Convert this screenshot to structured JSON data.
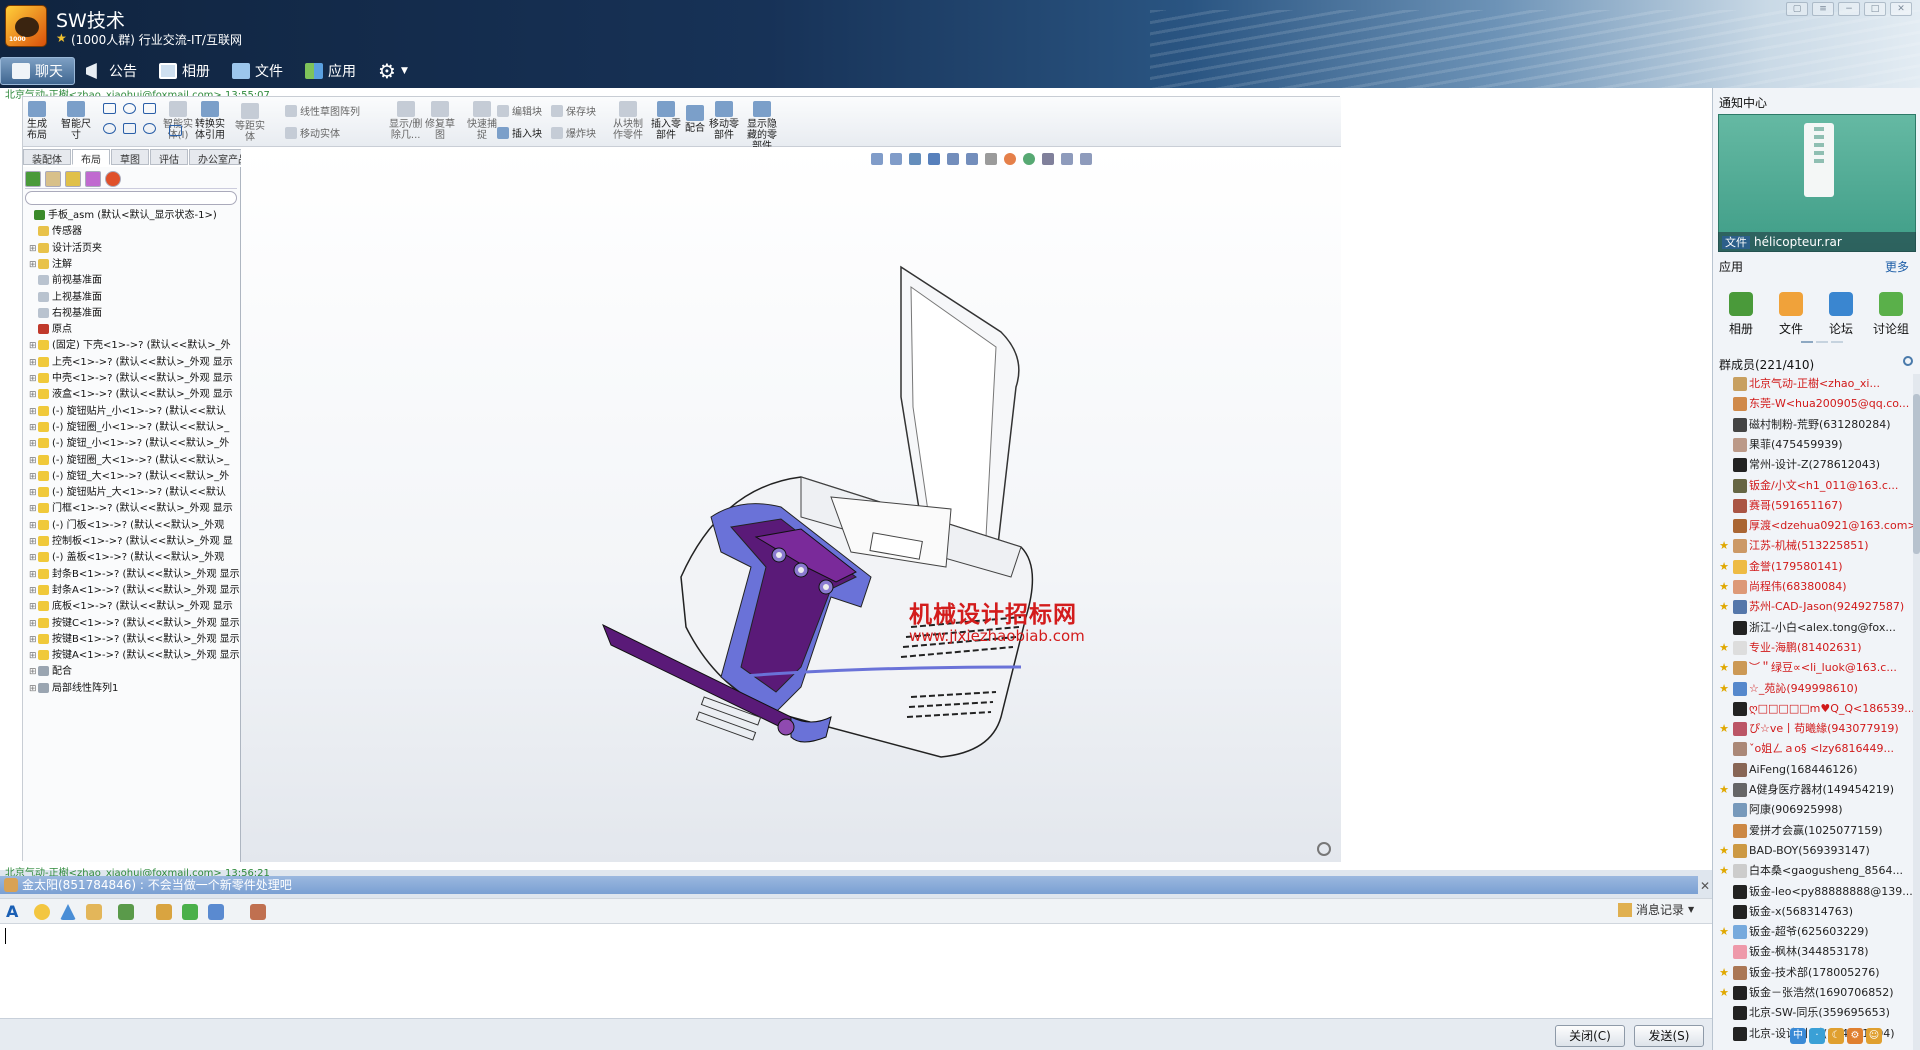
{
  "window": {
    "group_name": "SW技术",
    "group_desc": "(1000人群) 行业交流-IT/互联网",
    "tabs": [
      {
        "label": "聊天",
        "icon": "chat-icon"
      },
      {
        "label": "公告",
        "icon": "megaphone-icon"
      },
      {
        "label": "相册",
        "icon": "album-icon"
      },
      {
        "label": "文件",
        "icon": "folder-icon"
      },
      {
        "label": "应用",
        "icon": "apps-icon"
      }
    ]
  },
  "chat": {
    "msg1_meta": "北京气动-正樹<zhao_xiaohui@foxmail.com> 13:55:07",
    "msg2_meta": "北京气动-正樹<zhao_xiaohui@foxmail.com> 13:56:21",
    "quote": "金太阳(851784846) : 不会当做一个新零件处理吧",
    "history_label": "消息记录",
    "close_label": "关闭(C)",
    "send_label": "发送(S)"
  },
  "cad": {
    "ribbon": [
      {
        "label": "生成\n布局",
        "on": true
      },
      {
        "label": "智能尺\n寸",
        "on": true
      },
      {
        "label": "智能实\n体(I)",
        "on": false
      },
      {
        "label": "转换实\n体引用",
        "on": true
      },
      {
        "label": "等距实\n体",
        "on": false
      },
      {
        "label": "线性草图阵列",
        "on": false
      },
      {
        "label": "移动实体",
        "on": false
      },
      {
        "label": "显示/删\n除几...",
        "on": false
      },
      {
        "label": "修复草\n图",
        "on": false
      },
      {
        "label": "快速捕\n捉",
        "on": false
      },
      {
        "label": "编辑块",
        "on": false
      },
      {
        "label": "插入块",
        "on": true
      },
      {
        "label": "保存块",
        "on": false
      },
      {
        "label": "爆炸块",
        "on": false
      },
      {
        "label": "从块制\n作零件",
        "on": false
      },
      {
        "label": "插入零\n部件",
        "on": true
      },
      {
        "label": "配合",
        "on": true
      },
      {
        "label": "移动零\n部件",
        "on": true
      },
      {
        "label": "显示隐\n藏的零\n部件",
        "on": true
      }
    ],
    "cmd_tabs": [
      "装配体",
      "布局",
      "草图",
      "评估",
      "办公室产品"
    ],
    "tree": [
      {
        "label": "手板_asm  (默认<默认_显示状态-1>)",
        "indent": 0,
        "ex": "",
        "color": "#3a8a2a"
      },
      {
        "label": "传感器",
        "indent": 1,
        "ex": "",
        "color": "#e8c24a"
      },
      {
        "label": "设计活页夹",
        "indent": 1,
        "ex": "+",
        "color": "#e8c24a"
      },
      {
        "label": "注解",
        "indent": 1,
        "ex": "+",
        "color": "#e8c24a"
      },
      {
        "label": "前视基准面",
        "indent": 1,
        "ex": "",
        "color": "#b9c3cf"
      },
      {
        "label": "上视基准面",
        "indent": 1,
        "ex": "",
        "color": "#b9c3cf"
      },
      {
        "label": "右视基准面",
        "indent": 1,
        "ex": "",
        "color": "#b9c3cf"
      },
      {
        "label": "原点",
        "indent": 1,
        "ex": "",
        "color": "#c0392b"
      },
      {
        "label": "(固定) 下壳<1>->? (默认<<默认>_外",
        "indent": 1,
        "ex": "+",
        "color": "#f0c93a"
      },
      {
        "label": "上壳<1>->? (默认<<默认>_外观 显示",
        "indent": 1,
        "ex": "+",
        "color": "#f0c93a"
      },
      {
        "label": "中壳<1>->? (默认<<默认>_外观 显示",
        "indent": 1,
        "ex": "+",
        "color": "#f0c93a"
      },
      {
        "label": "液盒<1>->? (默认<<默认>_外观 显示",
        "indent": 1,
        "ex": "+",
        "color": "#f0c93a"
      },
      {
        "label": "(-) 旋钮贴片_小<1>->? (默认<<默认",
        "indent": 1,
        "ex": "+",
        "color": "#f0c93a"
      },
      {
        "label": "(-) 旋钮圈_小<1>->? (默认<<默认>_",
        "indent": 1,
        "ex": "+",
        "color": "#f0c93a"
      },
      {
        "label": "(-) 旋钮_小<1>->? (默认<<默认>_外",
        "indent": 1,
        "ex": "+",
        "color": "#f0c93a"
      },
      {
        "label": "(-) 旋钮圈_大<1>->? (默认<<默认>_",
        "indent": 1,
        "ex": "+",
        "color": "#f0c93a"
      },
      {
        "label": "(-) 旋钮_大<1>->? (默认<<默认>_外",
        "indent": 1,
        "ex": "+",
        "color": "#f0c93a"
      },
      {
        "label": "(-) 旋钮贴片_大<1>->? (默认<<默认",
        "indent": 1,
        "ex": "+",
        "color": "#f0c93a"
      },
      {
        "label": "门框<1>->? (默认<<默认>_外观 显示",
        "indent": 1,
        "ex": "+",
        "color": "#f0c93a"
      },
      {
        "label": "(-) 门板<1>->? (默认<<默认>_外观",
        "indent": 1,
        "ex": "+",
        "color": "#f0c93a"
      },
      {
        "label": "控制板<1>->? (默认<<默认>_外观 显",
        "indent": 1,
        "ex": "+",
        "color": "#f0c93a"
      },
      {
        "label": "(-) 盖板<1>->? (默认<<默认>_外观",
        "indent": 1,
        "ex": "+",
        "color": "#f0c93a"
      },
      {
        "label": "封条B<1>->? (默认<<默认>_外观 显示",
        "indent": 1,
        "ex": "+",
        "color": "#f0c93a"
      },
      {
        "label": "封条A<1>->? (默认<<默认>_外观 显示",
        "indent": 1,
        "ex": "+",
        "color": "#f0c93a"
      },
      {
        "label": "底板<1>->? (默认<<默认>_外观 显示",
        "indent": 1,
        "ex": "+",
        "color": "#f0c93a"
      },
      {
        "label": "按键C<1>->? (默认<<默认>_外观 显示",
        "indent": 1,
        "ex": "+",
        "color": "#f0c93a"
      },
      {
        "label": "按键B<1>->? (默认<<默认>_外观 显示",
        "indent": 1,
        "ex": "+",
        "color": "#f0c93a"
      },
      {
        "label": "按键A<1>->? (默认<<默认>_外观 显示",
        "indent": 1,
        "ex": "+",
        "color": "#f0c93a"
      },
      {
        "label": "配合",
        "indent": 1,
        "ex": "+",
        "color": "#9aa5b1"
      },
      {
        "label": "局部线性阵列1",
        "indent": 1,
        "ex": "+",
        "color": "#9aa5b1"
      }
    ],
    "watermark_cn": "机械设计招标网",
    "watermark_url": "www.jixiezhaobiab.com"
  },
  "sidebar": {
    "notif_title": "通知中心",
    "notif_tag": "文件",
    "notif_file": "hélicopteur.rar",
    "apps_title": "应用",
    "apps_more": "更多",
    "apps": [
      {
        "label": "相册",
        "color": "#4a9a3a"
      },
      {
        "label": "文件",
        "color": "#f0a23a"
      },
      {
        "label": "论坛",
        "color": "#3a86d0"
      },
      {
        "label": "讨论组",
        "color": "#5ab04a"
      }
    ],
    "members_title": "群成员(221/410)",
    "members": [
      {
        "name": "北京气动-正樹<zhao_xi...",
        "red": true,
        "star": false,
        "av": "#c8a060"
      },
      {
        "name": "东莞-W<hua200905@qq.co...",
        "red": true,
        "star": false,
        "av": "#d08a4a"
      },
      {
        "name": "磁村制粉-荒野(631280284)",
        "red": false,
        "star": false,
        "av": "#444"
      },
      {
        "name": "果菲(475459939)",
        "red": false,
        "star": false,
        "av": "#b98"
      },
      {
        "name": "常州-设计-Z(278612043)",
        "red": false,
        "star": false,
        "av": "#222"
      },
      {
        "name": "钣金/小文<h1_011@163.c...",
        "red": true,
        "star": false,
        "av": "#664"
      },
      {
        "name": "赛哥(591651167)",
        "red": true,
        "star": false,
        "av": "#a54"
      },
      {
        "name": "厚渡<dzehua0921@163.com>",
        "red": true,
        "star": false,
        "av": "#a63"
      },
      {
        "name": "江苏-机械(513225851)",
        "red": true,
        "star": true,
        "av": "#c96"
      },
      {
        "name": "金誉(179580141)",
        "red": true,
        "star": true,
        "av": "#eb4"
      },
      {
        "name": "尚程伟(68380084)",
        "red": true,
        "star": true,
        "av": "#d97"
      },
      {
        "name": "苏州-CAD-Jason(924927587)",
        "red": true,
        "star": true,
        "av": "#57a"
      },
      {
        "name": "浙江-小白<alex.tong@fox...",
        "red": false,
        "star": false,
        "av": "#222"
      },
      {
        "name": "专业-海鹏(81402631)",
        "red": true,
        "star": true,
        "av": "#ddd"
      },
      {
        "name": "︶＂绿豆∝<li_luok@163.c...",
        "red": true,
        "star": true,
        "av": "#c95"
      },
      {
        "name": "☆_苑訫(949998610)",
        "red": true,
        "star": true,
        "av": "#58c"
      },
      {
        "name": "ღ□□□□□m♥Q_Q<186539...",
        "red": true,
        "star": false,
        "av": "#222"
      },
      {
        "name": "ぴ☆ve丨苟曦緣(943077919)",
        "red": true,
        "star": true,
        "av": "#b56"
      },
      {
        "name": "ˇo姐ㄥａo§ <lzy6816449...",
        "red": true,
        "star": false,
        "av": "#a87"
      },
      {
        "name": "AiFeng(168446126)",
        "red": false,
        "star": false,
        "av": "#865"
      },
      {
        "name": "A健身医疗器材(149454219)",
        "red": false,
        "star": true,
        "av": "#666"
      },
      {
        "name": "阿康(906925998)",
        "red": false,
        "star": false,
        "av": "#79b"
      },
      {
        "name": "爱拼才会赢(1025077159)",
        "red": false,
        "star": false,
        "av": "#c84"
      },
      {
        "name": "BAD-BOY(569393147)",
        "red": false,
        "star": true,
        "av": "#c94"
      },
      {
        "name": "白本桑<gaogusheng_8564...",
        "red": false,
        "star": true,
        "av": "#ccc"
      },
      {
        "name": "钣金-leo<py88888888@139...",
        "red": false,
        "star": false,
        "av": "#222"
      },
      {
        "name": "钣金-x(568314763)",
        "red": false,
        "star": false,
        "av": "#222"
      },
      {
        "name": "钣金-超爷(625603229)",
        "red": false,
        "star": true,
        "av": "#7ad"
      },
      {
        "name": "钣金-枫林(344853178)",
        "red": false,
        "star": false,
        "av": "#e9a"
      },
      {
        "name": "钣金-技术部(178005276)",
        "red": false,
        "star": true,
        "av": "#a75"
      },
      {
        "name": "钣金－张浩然(1690706852)",
        "red": false,
        "star": true,
        "av": "#222"
      },
      {
        "name": "北京-SW-同乐(359695653)",
        "red": false,
        "star": false,
        "av": "#222"
      },
      {
        "name": "北京-设计-小乐(524631404)",
        "red": false,
        "star": false,
        "av": "#222"
      }
    ]
  },
  "colors": {
    "title_dark": "#10243f",
    "quote_bar": "#7aa0d3",
    "cad_purple": "#5a1a78",
    "cad_blue": "#6a72d8"
  }
}
